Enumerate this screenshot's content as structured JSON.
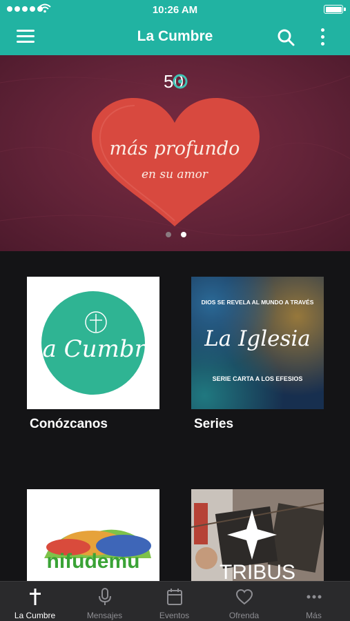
{
  "status_bar": {
    "time": "10:26 AM"
  },
  "app_bar": {
    "title": "La Cumbre"
  },
  "hero": {
    "badge": "50",
    "headline": "más profundo",
    "subline": "en su amor",
    "slide_count": 2,
    "active_slide": 2
  },
  "grid": {
    "items": [
      {
        "label": "Conózcanos",
        "art_text": "La Cumbre"
      },
      {
        "label": "Series",
        "art_top": "DIOS SE REVELA AL MUNDO A TRAVÉS",
        "art_title": "La Iglesia",
        "art_bottom": "SERIE CARTA A LOS EFESIOS"
      },
      {
        "label": "",
        "art_text": "nifudemu"
      },
      {
        "label": "",
        "art_text": "TRIBUS"
      }
    ]
  },
  "tabs": [
    {
      "label": "La Cumbre",
      "icon": "cross-icon",
      "active": true
    },
    {
      "label": "Mensajes",
      "icon": "microphone-icon",
      "active": false
    },
    {
      "label": "Eventos",
      "icon": "calendar-icon",
      "active": false
    },
    {
      "label": "Ofrenda",
      "icon": "heart-icon",
      "active": false
    },
    {
      "label": "Más",
      "icon": "ellipsis-icon",
      "active": false
    }
  ],
  "colors": {
    "accent": "#21b3a2",
    "hero_bg": "#622338",
    "heart": "#d8493f",
    "tab_bg": "#2a2a2c"
  }
}
